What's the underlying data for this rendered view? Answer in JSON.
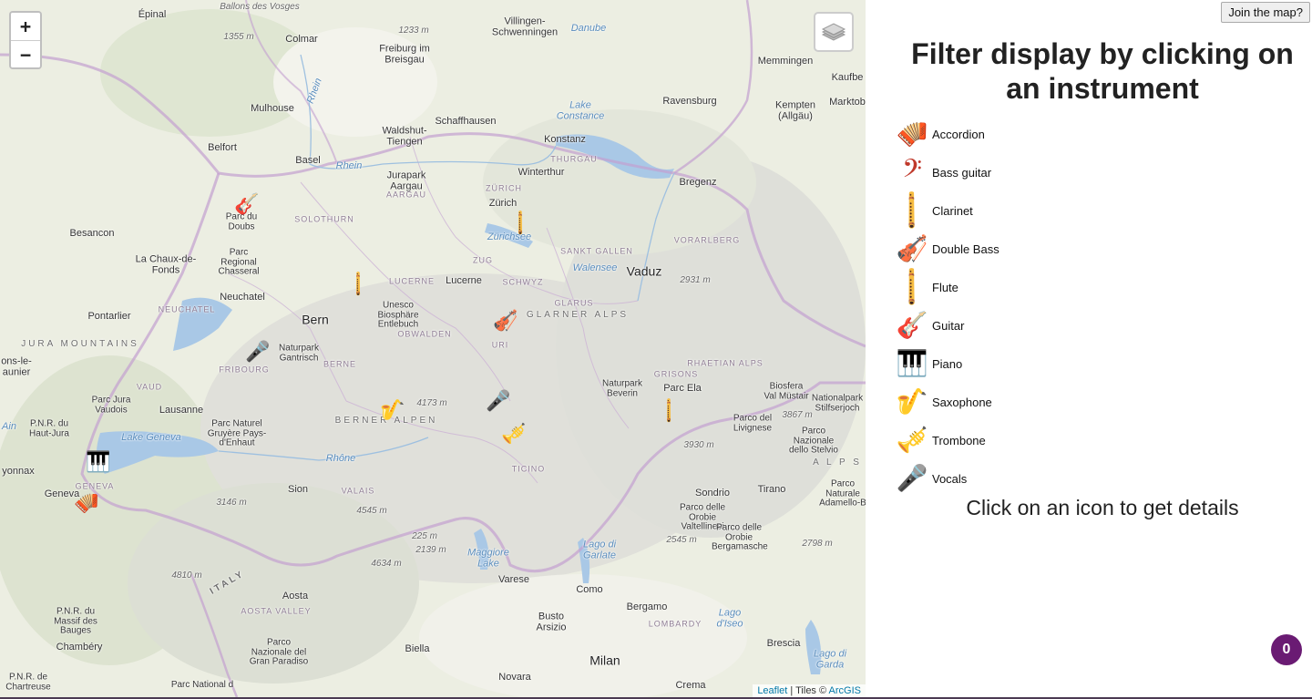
{
  "map": {
    "zoom_in": "+",
    "zoom_out": "−",
    "layers_icon": "layers-icon",
    "attribution": {
      "leaflet": "Leaflet",
      "sep": " | Tiles © ",
      "arcgis": "ArcGIS"
    },
    "labels": {
      "epinal": "Épinal",
      "ballons": "Ballons des Vosges",
      "colmar": "Colmar",
      "e1355": "1355 m",
      "e1233": "1233 m",
      "freiburg": "Freiburg im Breisgau",
      "villingen": "Villingen-Schwenningen",
      "donau": "Danube",
      "mulhouse": "Mulhouse",
      "rhein": "Rhein",
      "memmingen": "Memmingen",
      "kaufbeu": "Kaufbe",
      "marktob": "Marktob",
      "ravensburg": "Ravensburg",
      "kempten": "Kempten (Allgäu)",
      "lake_constance": "Lake Constance",
      "belfort": "Belfort",
      "waldshut": "Waldshut-Tiengen",
      "schaffhausen": "Schaffhausen",
      "konstanz": "Konstanz",
      "basel": "Basel",
      "rhein2": "Rhein",
      "winterthur": "Winterthur",
      "thurgau": "THURGAU",
      "jurapark": "Jurapark Aargau",
      "aargau": "AARGAU",
      "zurich_r": "ZÜRICH",
      "zurich": "Zürich",
      "bregenz": "Bregenz",
      "solothurn": "SOLOTHURN",
      "doubs": "Parc du Doubs",
      "besancon": "Besancon",
      "zurichsee": "Zürichsee",
      "vorarlberg": "VORARLBERG",
      "sanktgallen": "SANKT GALLEN",
      "chauxdefonds": "La Chaux-de-Fonds",
      "zug": "ZUG",
      "walensee": "Walensee",
      "vaduz": "Vaduz",
      "chasseral": "Parc Regional Chasseral",
      "schwyz": "SCHWYZ",
      "lucerne_r": "LUCERNE",
      "lucerne": "Lucerne",
      "e2931": "2931 m",
      "neuchatel": "Neuchatel",
      "glarus": "GLARUS",
      "neuchatel_r": "NEUCHATEL",
      "unesco": "Unesco Biosphäre Entlebuch",
      "glarner": "GLARNER ALPS",
      "pontarlier": "Pontarlier",
      "bern": "Bern",
      "obwalden": "OBWALDEN",
      "uri": "URI",
      "jura_mtns": "JURA MOUNTAINS",
      "gantrisch": "Naturpark Gantrisch",
      "ponsle": "ons-le-aunier",
      "berne_r": "BERNE",
      "fribourg": "FRIBOURG",
      "grisons": "GRISONS",
      "rhaetian": "RHAETIAN ALPS",
      "vaud": "VAUD",
      "bevarin": "Naturpark Beverin",
      "parcela": "Parc Ela",
      "biosfera": "Biosfera Val Müstair",
      "stilfserjoch": "Nationalpark Stilfserjoch",
      "jura_vaudois": "Parc Jura Vaudois",
      "lausanne": "Lausanne",
      "e4173": "4173 m",
      "berner_alpen": "BERNER ALPEN",
      "ain": "Ain",
      "pnr_haut_jura": "P.N.R. du Haut-Jura",
      "gruyere": "Parc Naturel Gruyère Pays-d'Enhaut",
      "lake_geneva": "Lake Geneva",
      "livigno": "Parco del Livignese",
      "e3867": "3867 m",
      "stelvio": "Parco Nazionale dello Stelvio",
      "rhone": "Rhône",
      "e3930": "3930 m",
      "ticino": "TICINO",
      "alps": "A L P S",
      "dyonnax": "yonnax",
      "geneva_r": "GENEVA",
      "geneva": "Geneva",
      "sion": "Sion",
      "valais": "VALAIS",
      "sondrio": "Sondrio",
      "tirano": "Tirano",
      "adamello": "Parco Naturale Adamello-B",
      "e3146": "3146 m",
      "e4545": "4545 m",
      "orobie": "Parco delle Orobie Valtellinesi",
      "orobie_b": "Parco delle Orobie Bergamasche",
      "e225": "225 m",
      "e2139": "2139 m",
      "e2545": "2545 m",
      "lago_garlate": "Lago di Garlate",
      "e2798": "2798 m",
      "maggiore": "Maggiore Lake",
      "e4634": "4634 m",
      "e4810": "4810 m",
      "varese": "Varese",
      "como": "Como",
      "italy": "ITALY",
      "aosta": "Aosta",
      "aosta_valley": "AOSTA VALLEY",
      "bergamo": "Bergamo",
      "lago_iseo": "Lago d'Iseo",
      "bauges": "P.N.R. du Massif des Bauges",
      "busto": "Busto Arsizio",
      "lombardy": "LOMBARDY",
      "chambery": "Chambéry",
      "gran_paradiso": "Parco Nazionale del Gran Paradiso",
      "biella": "Biella",
      "milan": "Milan",
      "brescia": "Brescia",
      "lago_garda": "Lago di Garda",
      "chartreuse": "P.N.R. de Chartreuse",
      "novara": "Novara",
      "crema": "Crema",
      "nationale_v": "Parc National d"
    },
    "markers": [
      {
        "name": "guitar-marker",
        "icon": "🎸"
      },
      {
        "name": "clarinet-marker-1",
        "icon": "🪈"
      },
      {
        "name": "flute-marker-1",
        "icon": "🪈"
      },
      {
        "name": "double-bass-marker",
        "icon": "🎻"
      },
      {
        "name": "vocals-marker-1",
        "icon": "🎤"
      },
      {
        "name": "saxophone-marker",
        "icon": "🎷"
      },
      {
        "name": "vocals-marker-2",
        "icon": "🎤"
      },
      {
        "name": "trombone-marker",
        "icon": "🎺"
      },
      {
        "name": "flute-marker-2",
        "icon": "🪈"
      },
      {
        "name": "piano-guitar-marker",
        "icon": "🎹"
      },
      {
        "name": "accordion-bass-marker",
        "icon": "🪗"
      }
    ]
  },
  "sidebar": {
    "join_button": "Join the map?",
    "title": "Filter display by clicking on an instrument",
    "instruments": [
      {
        "label": "Accordion",
        "icon": "🪗"
      },
      {
        "label": "Bass guitar",
        "icon": "𝄢"
      },
      {
        "label": "Clarinet",
        "icon": "🪈"
      },
      {
        "label": "Double Bass",
        "icon": "🎻"
      },
      {
        "label": "Flute",
        "icon": "🪈"
      },
      {
        "label": "Guitar",
        "icon": "🎸"
      },
      {
        "label": "Piano",
        "icon": "🎹"
      },
      {
        "label": "Saxophone",
        "icon": "🎷"
      },
      {
        "label": "Trombone",
        "icon": "🎺"
      },
      {
        "label": "Vocals",
        "icon": "🎤"
      }
    ],
    "hint": "Click on an icon to get details",
    "badge": "0",
    "badge_color": "#6a1b73"
  }
}
